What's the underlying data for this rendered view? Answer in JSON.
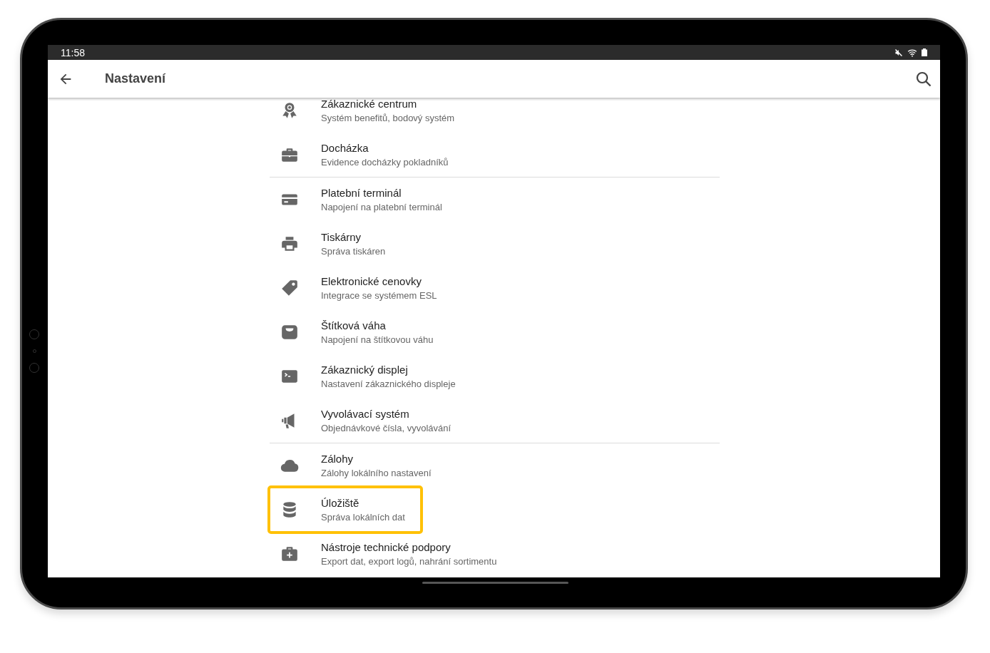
{
  "status_bar": {
    "time": "11:58"
  },
  "app_bar": {
    "title": "Nastavení"
  },
  "groups": [
    {
      "items": [
        {
          "title": "Zákaznické centrum",
          "subtitle": "Systém benefitů, bodový systém",
          "highlighted": false
        },
        {
          "title": "Docházka",
          "subtitle": "Evidence docházky pokladníků",
          "highlighted": false
        }
      ]
    },
    {
      "items": [
        {
          "title": "Platební terminál",
          "subtitle": "Napojení na platební terminál",
          "highlighted": false
        },
        {
          "title": "Tiskárny",
          "subtitle": "Správa tiskáren",
          "highlighted": false
        },
        {
          "title": "Elektronické cenovky",
          "subtitle": "Integrace se systémem ESL",
          "highlighted": false
        },
        {
          "title": "Štítková váha",
          "subtitle": "Napojení na štítkovou váhu",
          "highlighted": false
        },
        {
          "title": "Zákaznický displej",
          "subtitle": "Nastavení zákaznického displeje",
          "highlighted": false
        },
        {
          "title": "Vyvolávací systém",
          "subtitle": "Objednávkové čísla, vyvolávání",
          "highlighted": false
        }
      ]
    },
    {
      "items": [
        {
          "title": "Zálohy",
          "subtitle": "Zálohy lokálního nastavení",
          "highlighted": false
        },
        {
          "title": "Úložiště",
          "subtitle": "Správa lokálních dat",
          "highlighted": true
        },
        {
          "title": "Nástroje technické podpory",
          "subtitle": "Export dat, export logů, nahrání sortimentu",
          "highlighted": false
        }
      ]
    }
  ]
}
